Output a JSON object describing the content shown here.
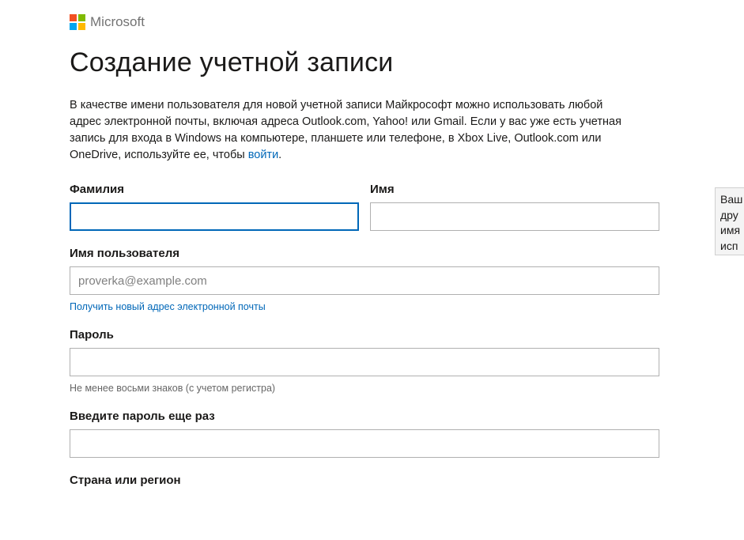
{
  "header": {
    "brand_name": "Microsoft"
  },
  "page_title": "Создание учетной записи",
  "intro": {
    "part1": "В качестве имени пользователя для новой учетной записи Майкрософт можно использовать любой адрес электронной почты, включая адреса Outlook.com, Yahoo! или Gmail. Если у вас уже есть учетная запись для входа в Windows на компьютере, планшете или телефоне, в Xbox Live, Outlook.com или OneDrive, используйте ее, чтобы ",
    "signin_link": "войти",
    "part2": "."
  },
  "form": {
    "last_name": {
      "label": "Фамилия",
      "value": ""
    },
    "first_name": {
      "label": "Имя",
      "value": ""
    },
    "username": {
      "label": "Имя пользователя",
      "placeholder": "proverka@example.com",
      "value": "",
      "new_email_link": "Получить новый адрес электронной почты"
    },
    "password": {
      "label": "Пароль",
      "value": "",
      "hint": "Не менее восьми знаков (с учетом регистра)"
    },
    "confirm_password": {
      "label": "Введите пароль еще раз",
      "value": ""
    },
    "country": {
      "label": "Страна или регион"
    }
  },
  "tooltip": {
    "line1": "Ваш",
    "line2": "дру",
    "line3": "имя",
    "line4": "исп"
  }
}
